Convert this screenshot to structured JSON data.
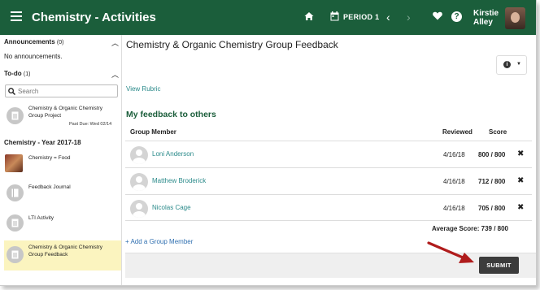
{
  "topbar": {
    "title": "Chemistry - Activities",
    "period": "PERIOD 1",
    "user_name_line1": "Kirstie",
    "user_name_line2": "Alley",
    "help_glyph": "?"
  },
  "sidebar": {
    "announcements_label": "Announcements",
    "announcements_count": "(0)",
    "no_announcements": "No announcements.",
    "todo_label": "To-do",
    "todo_count": "(1)",
    "search_placeholder": "Search",
    "todo_items": [
      {
        "line1": "Chemistry & Organic Chemistry",
        "line2": "Group Project",
        "due": "Past Due: Wed 02/14"
      }
    ],
    "course_label": "Chemistry - Year 2017-18",
    "course_items": [
      {
        "line1": "Chemistry = Food",
        "line2": ""
      },
      {
        "line1": "Feedback Journal",
        "line2": ""
      },
      {
        "line1": "LTI Activity",
        "line2": ""
      },
      {
        "line1": "Chemistry & Organic Chemistry",
        "line2": "Group Feedback"
      }
    ]
  },
  "main": {
    "title": "Chemistry & Organic Chemistry Group Feedback",
    "view_rubric": "View Rubric",
    "feedback_heading": "My feedback to others",
    "columns": {
      "member": "Group Member",
      "reviewed": "Reviewed",
      "score": "Score"
    },
    "rows": [
      {
        "name": "Loni Anderson",
        "reviewed": "4/16/18",
        "score": "800 / 800"
      },
      {
        "name": "Matthew Broderick",
        "reviewed": "4/16/18",
        "score": "712 / 800"
      },
      {
        "name": "Nicolas Cage",
        "reviewed": "4/16/18",
        "score": "705 / 800"
      }
    ],
    "average_score": "Average Score: 739 / 800",
    "add_member": "Add a Group Member",
    "submit": "SUBMIT"
  },
  "colors": {
    "header": "#1b5e3b",
    "link": "#2a8a8a",
    "highlight": "#fbf4bf",
    "arrow": "#b01c1c"
  },
  "icons": [
    "menu-icon",
    "home-icon",
    "calendar-icon",
    "chevron-left-icon",
    "chevron-right-icon",
    "heart-icon",
    "help-icon",
    "info-icon",
    "remove-icon",
    "plus-icon",
    "search-icon",
    "document-icon"
  ]
}
